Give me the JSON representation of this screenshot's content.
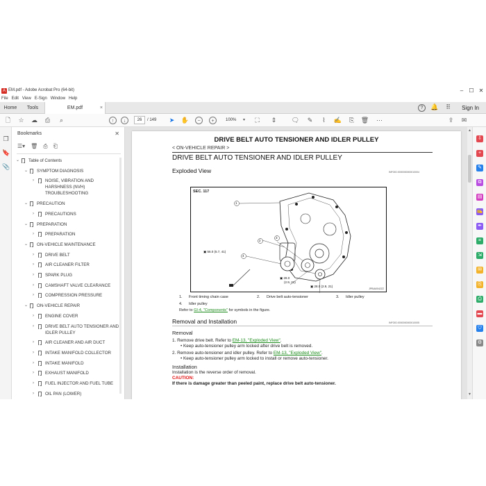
{
  "window": {
    "title": "EM.pdf - Adobe Acrobat Pro (64-bit)",
    "logo": "A",
    "controls": [
      "–",
      "☐",
      "✕"
    ]
  },
  "menu": [
    "File",
    "Edit",
    "View",
    "E-Sign",
    "Window",
    "Help"
  ],
  "tabs": {
    "home": "Home",
    "tools": "Tools",
    "document": "EM.pdf",
    "close": "×",
    "help_icon": "?",
    "sign_in": "Sign In"
  },
  "toolbar": {
    "current_page": "26",
    "page_total": "/ 149",
    "zoom": "100%",
    "icons": [
      "new-file-icon",
      "star-icon",
      "upload-icon",
      "print-icon",
      "search-icon",
      "prev-page-icon",
      "next-page-icon",
      "cursor-icon",
      "hand-icon",
      "zoom-out-icon",
      "zoom-in-icon",
      "zoom-dropdown-icon",
      "fit-icon",
      "scroll-mode-icon",
      "comment-icon",
      "pen-icon",
      "highlight-icon",
      "sign-icon",
      "stamp-icon",
      "delete-icon",
      "more-icon",
      "share-icon",
      "email-icon"
    ]
  },
  "bookmarks": {
    "title": "Bookmarks",
    "items": [
      {
        "label": "Table of Contents",
        "level": 0,
        "expanded": true
      },
      {
        "label": "SYMPTOM DIAGNOSIS",
        "level": 1,
        "expanded": true
      },
      {
        "label": "NOISE, VIBRATION AND",
        "level": 2,
        "expanded": false
      },
      {
        "label": "HARSHNESS (NVH)",
        "level": 2,
        "cont": true
      },
      {
        "label": "TROUBLESHOOTING",
        "level": 2,
        "cont": true
      },
      {
        "label": "PRECAUTION",
        "level": 1,
        "expanded": true
      },
      {
        "label": "PRECAUTIONS",
        "level": 2,
        "expanded": false
      },
      {
        "label": "PREPARATION",
        "level": 1,
        "expanded": true
      },
      {
        "label": "PREPARATION",
        "level": 2,
        "expanded": false
      },
      {
        "label": "ON-VEHICLE MAINTENANCE",
        "level": 1,
        "expanded": true
      },
      {
        "label": "DRIVE BELT",
        "level": 2,
        "expanded": false
      },
      {
        "label": "AIR CLEANER FILTER",
        "level": 2,
        "expanded": false
      },
      {
        "label": "SPARK PLUG",
        "level": 2,
        "expanded": false
      },
      {
        "label": "CAMSHAFT VALVE CLEARANCE",
        "level": 2,
        "expanded": false
      },
      {
        "label": "COMPRESSION PRESSURE",
        "level": 2,
        "expanded": false
      },
      {
        "label": "ON-VEHICLE REPAIR",
        "level": 1,
        "expanded": true
      },
      {
        "label": "ENGINE COVER",
        "level": 2,
        "expanded": false
      },
      {
        "label": "DRIVE BELT AUTO TENSIONER AND",
        "level": 2,
        "expanded": false
      },
      {
        "label": "IDLER PULLEY",
        "level": 2,
        "cont": true
      },
      {
        "label": "AIR CLEANER AND AIR DUCT",
        "level": 2,
        "expanded": false
      },
      {
        "label": "INTAKE MANIFOLD COLLECTOR",
        "level": 2,
        "expanded": false
      },
      {
        "label": "INTAKE MANIFOLD",
        "level": 2,
        "expanded": false
      },
      {
        "label": "EXHAUST MANIFOLD",
        "level": 2,
        "expanded": false
      },
      {
        "label": "FUEL INJECTOR AND FUEL TUBE",
        "level": 2,
        "expanded": false
      },
      {
        "label": "OIL PAN (LOWER)",
        "level": 2,
        "expanded": false
      }
    ]
  },
  "page": {
    "header": "DRIVE BELT AUTO TENSIONER AND IDLER PULLEY",
    "breadcrumb": "< ON-VEHICLE REPAIR >",
    "heading": "DRIVE BELT AUTO TENSIONER AND IDLER PULLEY",
    "exploded_view": "Exploded View",
    "exploded_code": "INFOID:0000000000010004",
    "figure": {
      "sec": "SEC. 117",
      "callout_1": "1",
      "callout_2": "2",
      "callout_3": "3",
      "callout_4": "4",
      "torque_1": "56.0 (5.7, 41)",
      "torque_2": "28.0",
      "torque_2b": "(2.9, 21)",
      "torque_3": "28.0 (2.9, 21)",
      "fig_id": "JPBIA0042ZZ"
    },
    "legend": [
      {
        "num": "1.",
        "text": "Front timing chain case"
      },
      {
        "num": "2.",
        "text": "Drive belt auto-tensioner"
      },
      {
        "num": "3.",
        "text": "Idler pulley"
      },
      {
        "num": "4.",
        "text": "Idler pulley"
      }
    ],
    "refer_prefix": "Refer to",
    "refer_link": "GI-4, \"Components\"",
    "refer_suffix": "for symbols in the figure.",
    "removal_title": "Removal and Installation",
    "removal_code": "INFOID:0000000000010005",
    "removal": "Removal",
    "step1_prefix": "1.   Remove drive belt. Refer to",
    "step1_link": "EM-13, \"Exploded View\"",
    "step1_note": "•  Keep auto-tensioner pulley arm locked after drive belt is removed.",
    "step2_prefix": "2.   Remove auto-tensioner and idler pulley. Refer to",
    "step2_link": "EM-13, \"Exploded View\"",
    "step2_note": "•  Keep auto-tensioner pulley arm locked to install or remove auto-tensioner.",
    "installation": "Installation",
    "install_text": "Installation is the reverse order of removal.",
    "caution_label": "CAUTION:",
    "caution_text": "If there is damage greater than peeled paint, replace drive belt auto-tensioner."
  },
  "colors": {
    "accent": "#1473e6",
    "link": "#1a8a1a",
    "caution": "#e01010",
    "logo": "#d42e24"
  }
}
